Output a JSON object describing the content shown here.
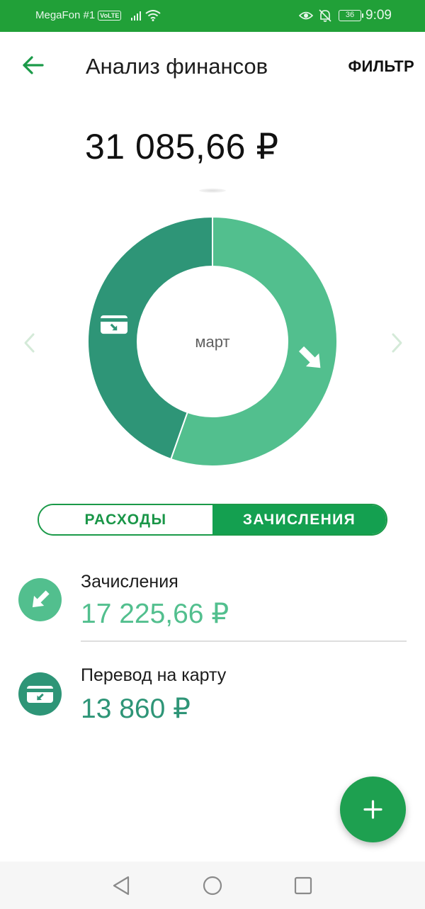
{
  "status_bar": {
    "carrier": "MegaFon #1",
    "volte": "VoLTE",
    "battery": "36",
    "time": "9:09"
  },
  "header": {
    "title": "Анализ финансов",
    "filter_label": "ФИЛЬТР",
    "back_icon": "arrow-left-icon"
  },
  "total": "31 085,66 ₽",
  "chart": {
    "center_label": "март"
  },
  "chart_data": {
    "type": "pie",
    "categories": [
      "Зачисления",
      "Перевод на карту"
    ],
    "values": [
      17225.66,
      13860
    ],
    "colors": [
      "#52bf8e",
      "#2e9577"
    ],
    "icons": [
      "arrow-down-right-icon",
      "card-transfer-icon"
    ]
  },
  "toggle": {
    "options": [
      "РАСХОДЫ",
      "ЗАЧИСЛЕНИЯ"
    ],
    "selected": "ЗАЧИСЛЕНИЯ"
  },
  "categories": [
    {
      "name": "Зачисления",
      "amount": "17 225,66 ₽",
      "color": "#52bf8e",
      "icon": "arrow-down-right-icon"
    },
    {
      "name": "Перевод на карту",
      "amount": "13 860 ₽",
      "color": "#2e9577",
      "icon": "card-transfer-icon"
    }
  ],
  "colors": {
    "brand_green": "#21a038",
    "toggle_green": "#14a050",
    "fab_green": "#1ea050",
    "nav_arrow": "#d4ead8"
  }
}
